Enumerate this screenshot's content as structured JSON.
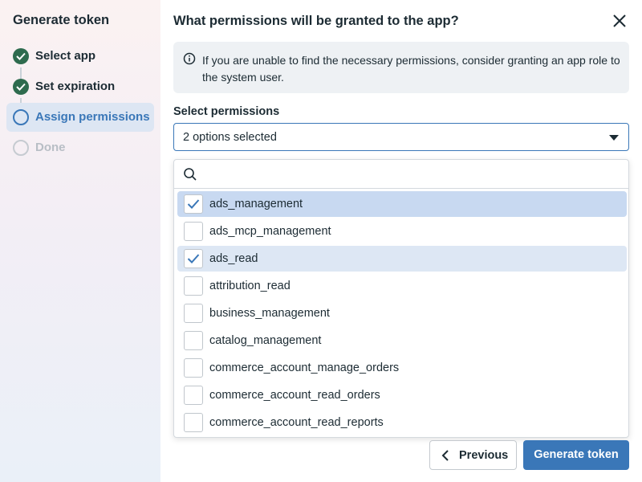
{
  "sidebar": {
    "title": "Generate token",
    "steps": [
      {
        "label": "Select app",
        "status": "done"
      },
      {
        "label": "Set expiration",
        "status": "done"
      },
      {
        "label": "Assign permissions",
        "status": "current"
      },
      {
        "label": "Done",
        "status": "pending"
      }
    ]
  },
  "dialog": {
    "title": "What permissions will be granted to the app?",
    "info_text": "If you are unable to find the necessary permissions, consider granting an app role to the system user.",
    "field_label": "Select permissions",
    "select_value": "2 options selected",
    "search_placeholder": "",
    "options": [
      {
        "label": "ads_management",
        "checked": true
      },
      {
        "label": "ads_mcp_management",
        "checked": false
      },
      {
        "label": "ads_read",
        "checked": true
      },
      {
        "label": "attribution_read",
        "checked": false
      },
      {
        "label": "business_management",
        "checked": false
      },
      {
        "label": "catalog_management",
        "checked": false
      },
      {
        "label": "commerce_account_manage_orders",
        "checked": false
      },
      {
        "label": "commerce_account_read_orders",
        "checked": false
      },
      {
        "label": "commerce_account_read_reports",
        "checked": false
      }
    ]
  },
  "footer": {
    "previous_label": "Previous",
    "generate_label": "Generate token"
  },
  "colors": {
    "accent": "#3a77b8",
    "done_step": "#2e6b4e",
    "selected_row": "#c8d9f1"
  },
  "icons": {
    "close": "close-icon",
    "info": "info-icon",
    "search": "search-icon",
    "caret": "caret-down-icon",
    "check": "check-icon",
    "previous": "chevron-left-icon"
  }
}
